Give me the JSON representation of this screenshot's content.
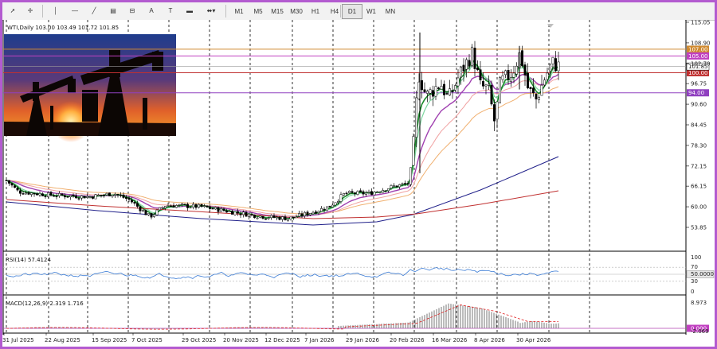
{
  "toolbar": {
    "tools": [
      {
        "name": "cursor-icon",
        "glyph": "➚"
      },
      {
        "name": "crosshair-icon",
        "glyph": "✛"
      },
      {
        "name": "vertical-line-icon",
        "glyph": "│"
      },
      {
        "name": "horizontal-line-icon",
        "glyph": "—"
      },
      {
        "name": "trendline-icon",
        "glyph": "╱"
      },
      {
        "name": "channel-icon",
        "glyph": "▤"
      },
      {
        "name": "fibonacci-icon",
        "glyph": "⊟"
      },
      {
        "name": "text-icon",
        "glyph": "A"
      },
      {
        "name": "label-icon",
        "glyph": "T"
      },
      {
        "name": "rectangle-icon",
        "glyph": "▬"
      },
      {
        "name": "shapes-dropdown-icon",
        "glyph": "⬌▾"
      }
    ],
    "timeframes": [
      "M1",
      "M5",
      "M15",
      "M30",
      "H1",
      "H4",
      "D1",
      "W1",
      "MN"
    ],
    "active_timeframe": "D1"
  },
  "header": {
    "symbol_label": "WTI,Daily  103.00  103.49  101.72  101.85"
  },
  "price_axis": {
    "ticks": [
      "115.05",
      "108.90",
      "102.70",
      "96.75",
      "90.60",
      "84.45",
      "78.30",
      "72.15",
      "66.15",
      "60.00",
      "53.85"
    ],
    "current_price": "101.85",
    "levels": [
      {
        "label": "107.00",
        "color": "#d08a30"
      },
      {
        "label": "105.00",
        "color": "#c040c0"
      },
      {
        "label": "100.00",
        "color": "#c03030"
      },
      {
        "label": "94.00",
        "color": "#9040c0"
      }
    ]
  },
  "rsi": {
    "label": "RSI(14) 57.4124",
    "ticks": [
      "100",
      "70",
      "50.0000",
      "30",
      "0"
    ]
  },
  "macd": {
    "label": "MACD(12,26,9) 2.319 1.716",
    "ticks": [
      "8.973",
      "0.000",
      "-2.069"
    ]
  },
  "date_axis": {
    "labels": [
      "31 Jul 2025",
      "22 Aug 2025",
      "15 Sep 2025",
      "7 Oct 2025",
      "29 Oct 2025",
      "20 Nov 2025",
      "12 Dec 2025",
      "7 Jan 2026",
      "29 Jan 2026",
      "20 Feb 2026",
      "16 Mar 2026",
      "8 Apr 2026",
      "30 Apr 2026"
    ]
  },
  "colors": {
    "border": "#b35bd0",
    "grid": "#000000",
    "bull_candle": "#ffffff",
    "bear_candle": "#000000",
    "ma_fast": "#1a8a2a",
    "ma_lightgreen": "#7ed6a0",
    "ma_purple": "#a040b0",
    "ma_pink": "#f0a0a0",
    "ma_orange": "#f0b070",
    "ma_navy": "#20208a",
    "ma_red": "#c03030",
    "rsi_line": "#3a7bd5",
    "macd_hist": "#b0b0b0",
    "macd_signal": "#e02020"
  }
}
